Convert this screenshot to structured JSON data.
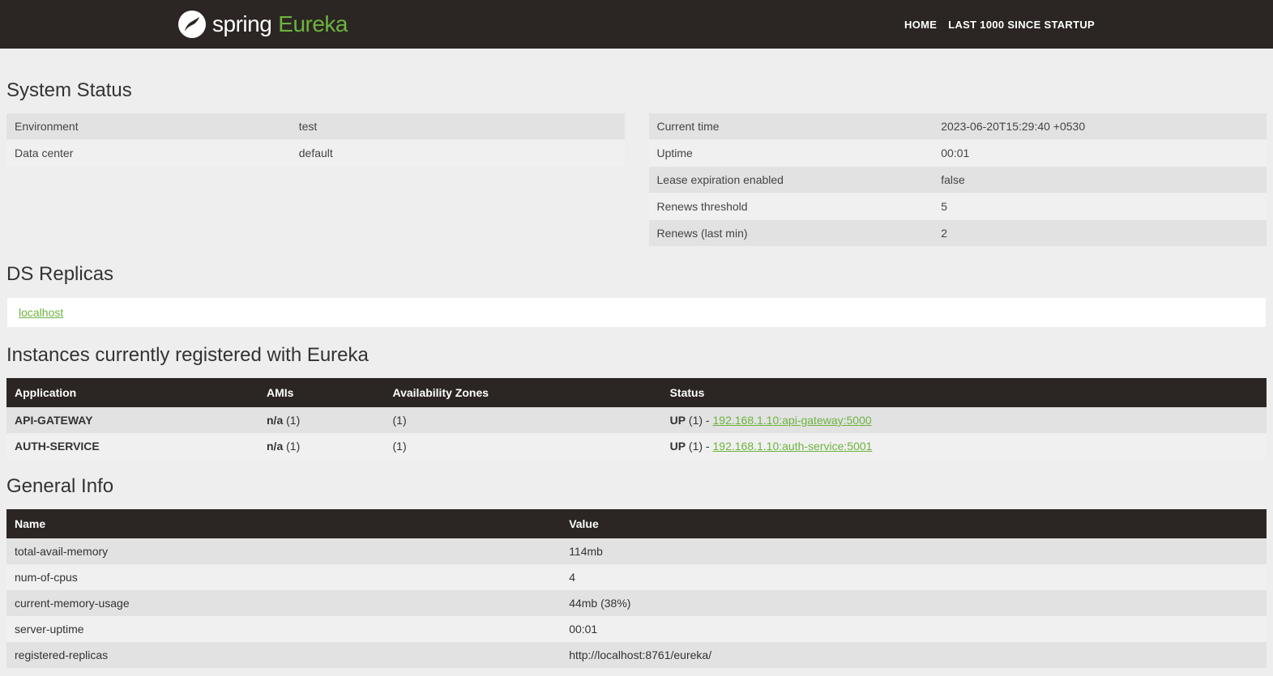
{
  "nav": {
    "brand_spring": "spring",
    "brand_eureka": "Eureka",
    "links": [
      {
        "label": "HOME"
      },
      {
        "label": "LAST 1000 SINCE STARTUP"
      }
    ]
  },
  "sections": {
    "system_status": "System Status",
    "ds_replicas": "DS Replicas",
    "instances": "Instances currently registered with Eureka",
    "general_info": "General Info"
  },
  "system_status_left": [
    {
      "label": "Environment",
      "value": "test"
    },
    {
      "label": "Data center",
      "value": "default"
    }
  ],
  "system_status_right": [
    {
      "label": "Current time",
      "value": "2023-06-20T15:29:40 +0530"
    },
    {
      "label": "Uptime",
      "value": "00:01"
    },
    {
      "label": "Lease expiration enabled",
      "value": "false"
    },
    {
      "label": "Renews threshold",
      "value": "5"
    },
    {
      "label": "Renews (last min)",
      "value": "2"
    }
  ],
  "ds_replicas": [
    {
      "label": "localhost"
    }
  ],
  "instances_table": {
    "headers": {
      "application": "Application",
      "amis": "AMIs",
      "zones": "Availability Zones",
      "status": "Status"
    },
    "rows": [
      {
        "application": "API-GATEWAY",
        "amis_prefix": "n/a",
        "amis_count": " (1)",
        "zones": "(1)",
        "status_prefix": "UP",
        "status_count": " (1)",
        "separator": " - ",
        "instance_link": "192.168.1.10:api-gateway:5000"
      },
      {
        "application": "AUTH-SERVICE",
        "amis_prefix": "n/a",
        "amis_count": " (1)",
        "zones": "(1)",
        "status_prefix": "UP",
        "status_count": " (1)",
        "separator": " - ",
        "instance_link": "192.168.1.10:auth-service:5001"
      }
    ]
  },
  "general_info": {
    "headers": {
      "name": "Name",
      "value": "Value"
    },
    "rows": [
      {
        "name": "total-avail-memory",
        "value": "114mb"
      },
      {
        "name": "num-of-cpus",
        "value": "4"
      },
      {
        "name": "current-memory-usage",
        "value": "44mb (38%)"
      },
      {
        "name": "server-uptime",
        "value": "00:01"
      },
      {
        "name": "registered-replicas",
        "value": "http://localhost:8761/eureka/"
      }
    ]
  }
}
